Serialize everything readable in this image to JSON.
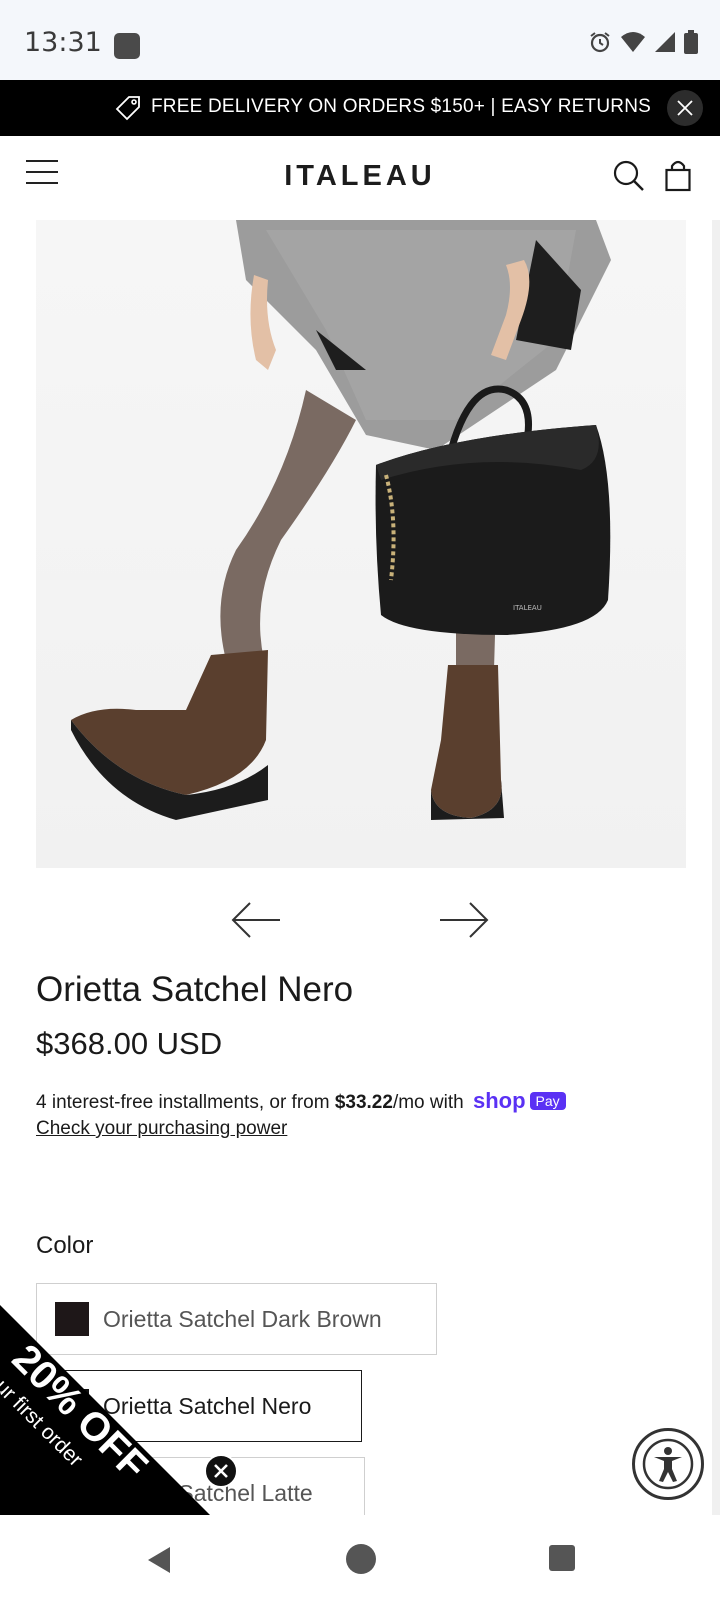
{
  "status_bar": {
    "time": "13:31"
  },
  "promo": {
    "text": "FREE DELIVERY ON ORDERS $150+ | EASY RETURNS"
  },
  "header": {
    "brand": "ITALEAU"
  },
  "product": {
    "title": "Orietta Satchel Nero",
    "price": "$368.00 USD",
    "installments_prefix": "4 interest-free installments, or from ",
    "installments_amount": "$33.22",
    "installments_suffix": "/mo with",
    "shop_logo": "shop",
    "pay_badge": "Pay",
    "check_link": "Check your purchasing power",
    "bag_logo": "ITALEAU"
  },
  "color": {
    "label": "Color",
    "options": [
      {
        "label": "Orietta Satchel Dark Brown",
        "chip_color": "#1e1718",
        "selected": false
      },
      {
        "label": "Orietta Satchel Nero",
        "chip_color": "#111111",
        "selected": true
      },
      {
        "label": "Orietta Satchel Latte",
        "chip_color": "#c9a98a",
        "selected": false
      }
    ]
  },
  "discount": {
    "headline": "20% OFF",
    "subline": "Your first order"
  },
  "colors": {
    "promo_bg": "#000000",
    "shop_purple": "#5a31f4"
  }
}
